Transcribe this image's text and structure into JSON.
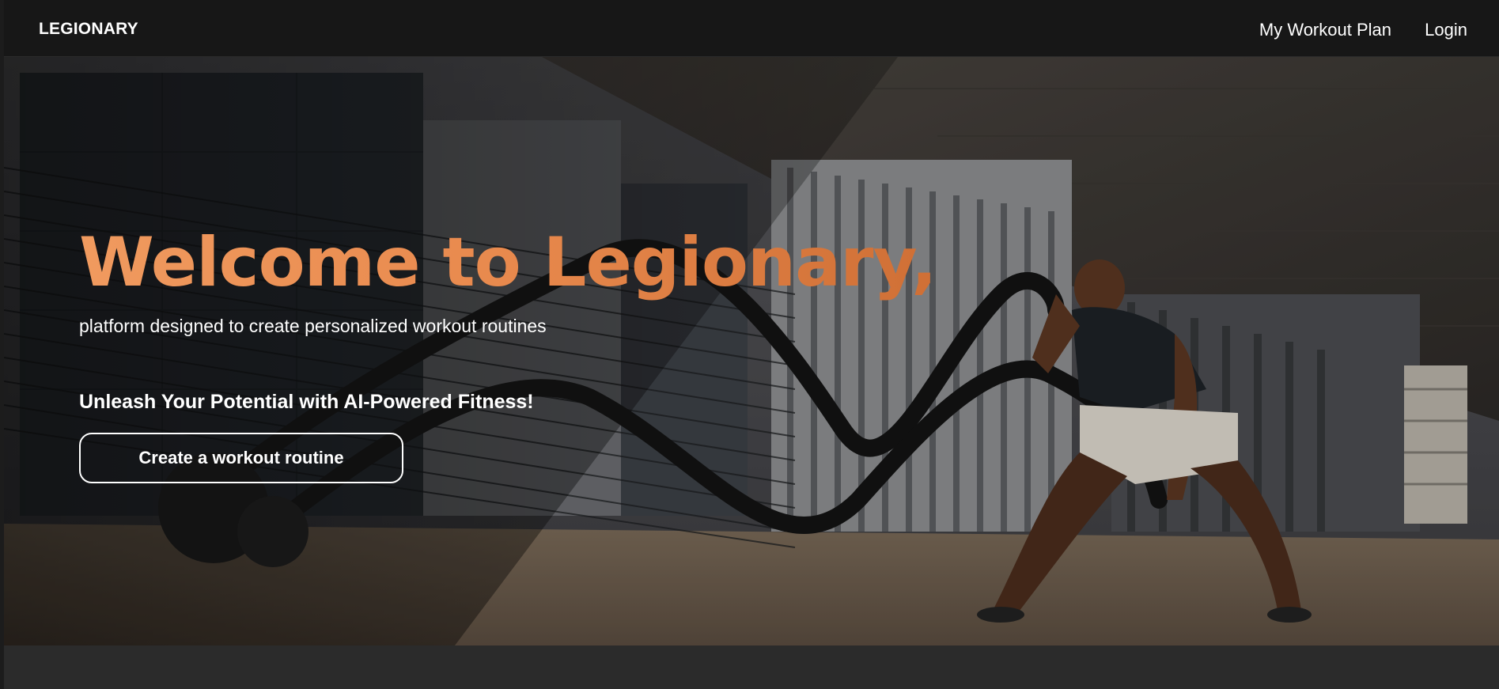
{
  "navbar": {
    "brand": "LEGIONARY",
    "links": [
      {
        "label": "My Workout Plan"
      },
      {
        "label": "Login"
      }
    ]
  },
  "hero": {
    "title": "Welcome to Legionary,",
    "subtitle": "platform designed to create personalized workout routines",
    "tagline": "Unleash Your Potential with AI-Powered Fitness!",
    "cta_label": "Create a workout routine",
    "background_image": "athlete-battle-ropes-photo"
  },
  "colors": {
    "navbar_bg": "#171717",
    "accent_gradient_start": "#f09a5f",
    "accent_gradient_end": "#cf6f35",
    "text": "#ffffff",
    "page_bg": "#2b2b2b"
  }
}
